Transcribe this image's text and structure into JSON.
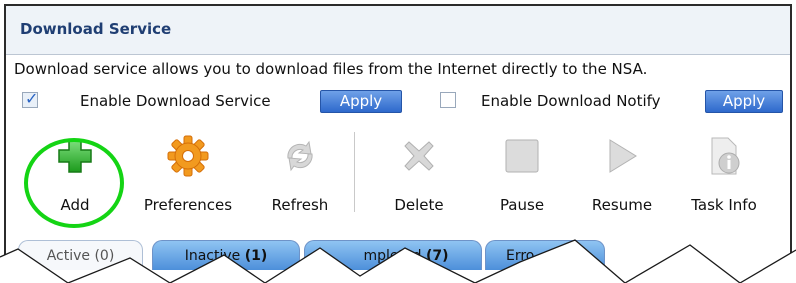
{
  "panel": {
    "title": "Download Service"
  },
  "description": "Download service allows you to download files from the Internet directly to the NSA.",
  "options": {
    "download_service": {
      "label": "Enable Download Service",
      "checked": true,
      "apply_label": "Apply"
    },
    "download_notify": {
      "label": "Enable Download Notify",
      "checked": false,
      "apply_label": "Apply"
    }
  },
  "toolbar": {
    "add": {
      "label": "Add",
      "icon": "plus-icon",
      "highlighted": true
    },
    "preferences": {
      "label": "Preferences",
      "icon": "gear-icon"
    },
    "refresh": {
      "label": "Refresh",
      "icon": "refresh-icon",
      "disabled": true
    },
    "delete": {
      "label": "Delete",
      "icon": "delete-icon",
      "disabled": true
    },
    "pause": {
      "label": "Pause",
      "icon": "pause-icon",
      "disabled": true
    },
    "resume": {
      "label": "Resume",
      "icon": "play-icon",
      "disabled": true
    },
    "task_info": {
      "label": "Task Info",
      "icon": "info-icon",
      "disabled": true
    }
  },
  "tabs": {
    "active": {
      "label": "Active",
      "count": "(0)"
    },
    "inactive": {
      "label": "Inactive",
      "count": "(1)"
    },
    "completed": {
      "label": "mpleted",
      "count": "(7)"
    },
    "error": {
      "label": "Erro"
    }
  },
  "colors": {
    "title": "#1f3e73",
    "apply_button": "#2e69cc",
    "highlight_circle": "#14d414",
    "tab": "#6da8e6"
  }
}
